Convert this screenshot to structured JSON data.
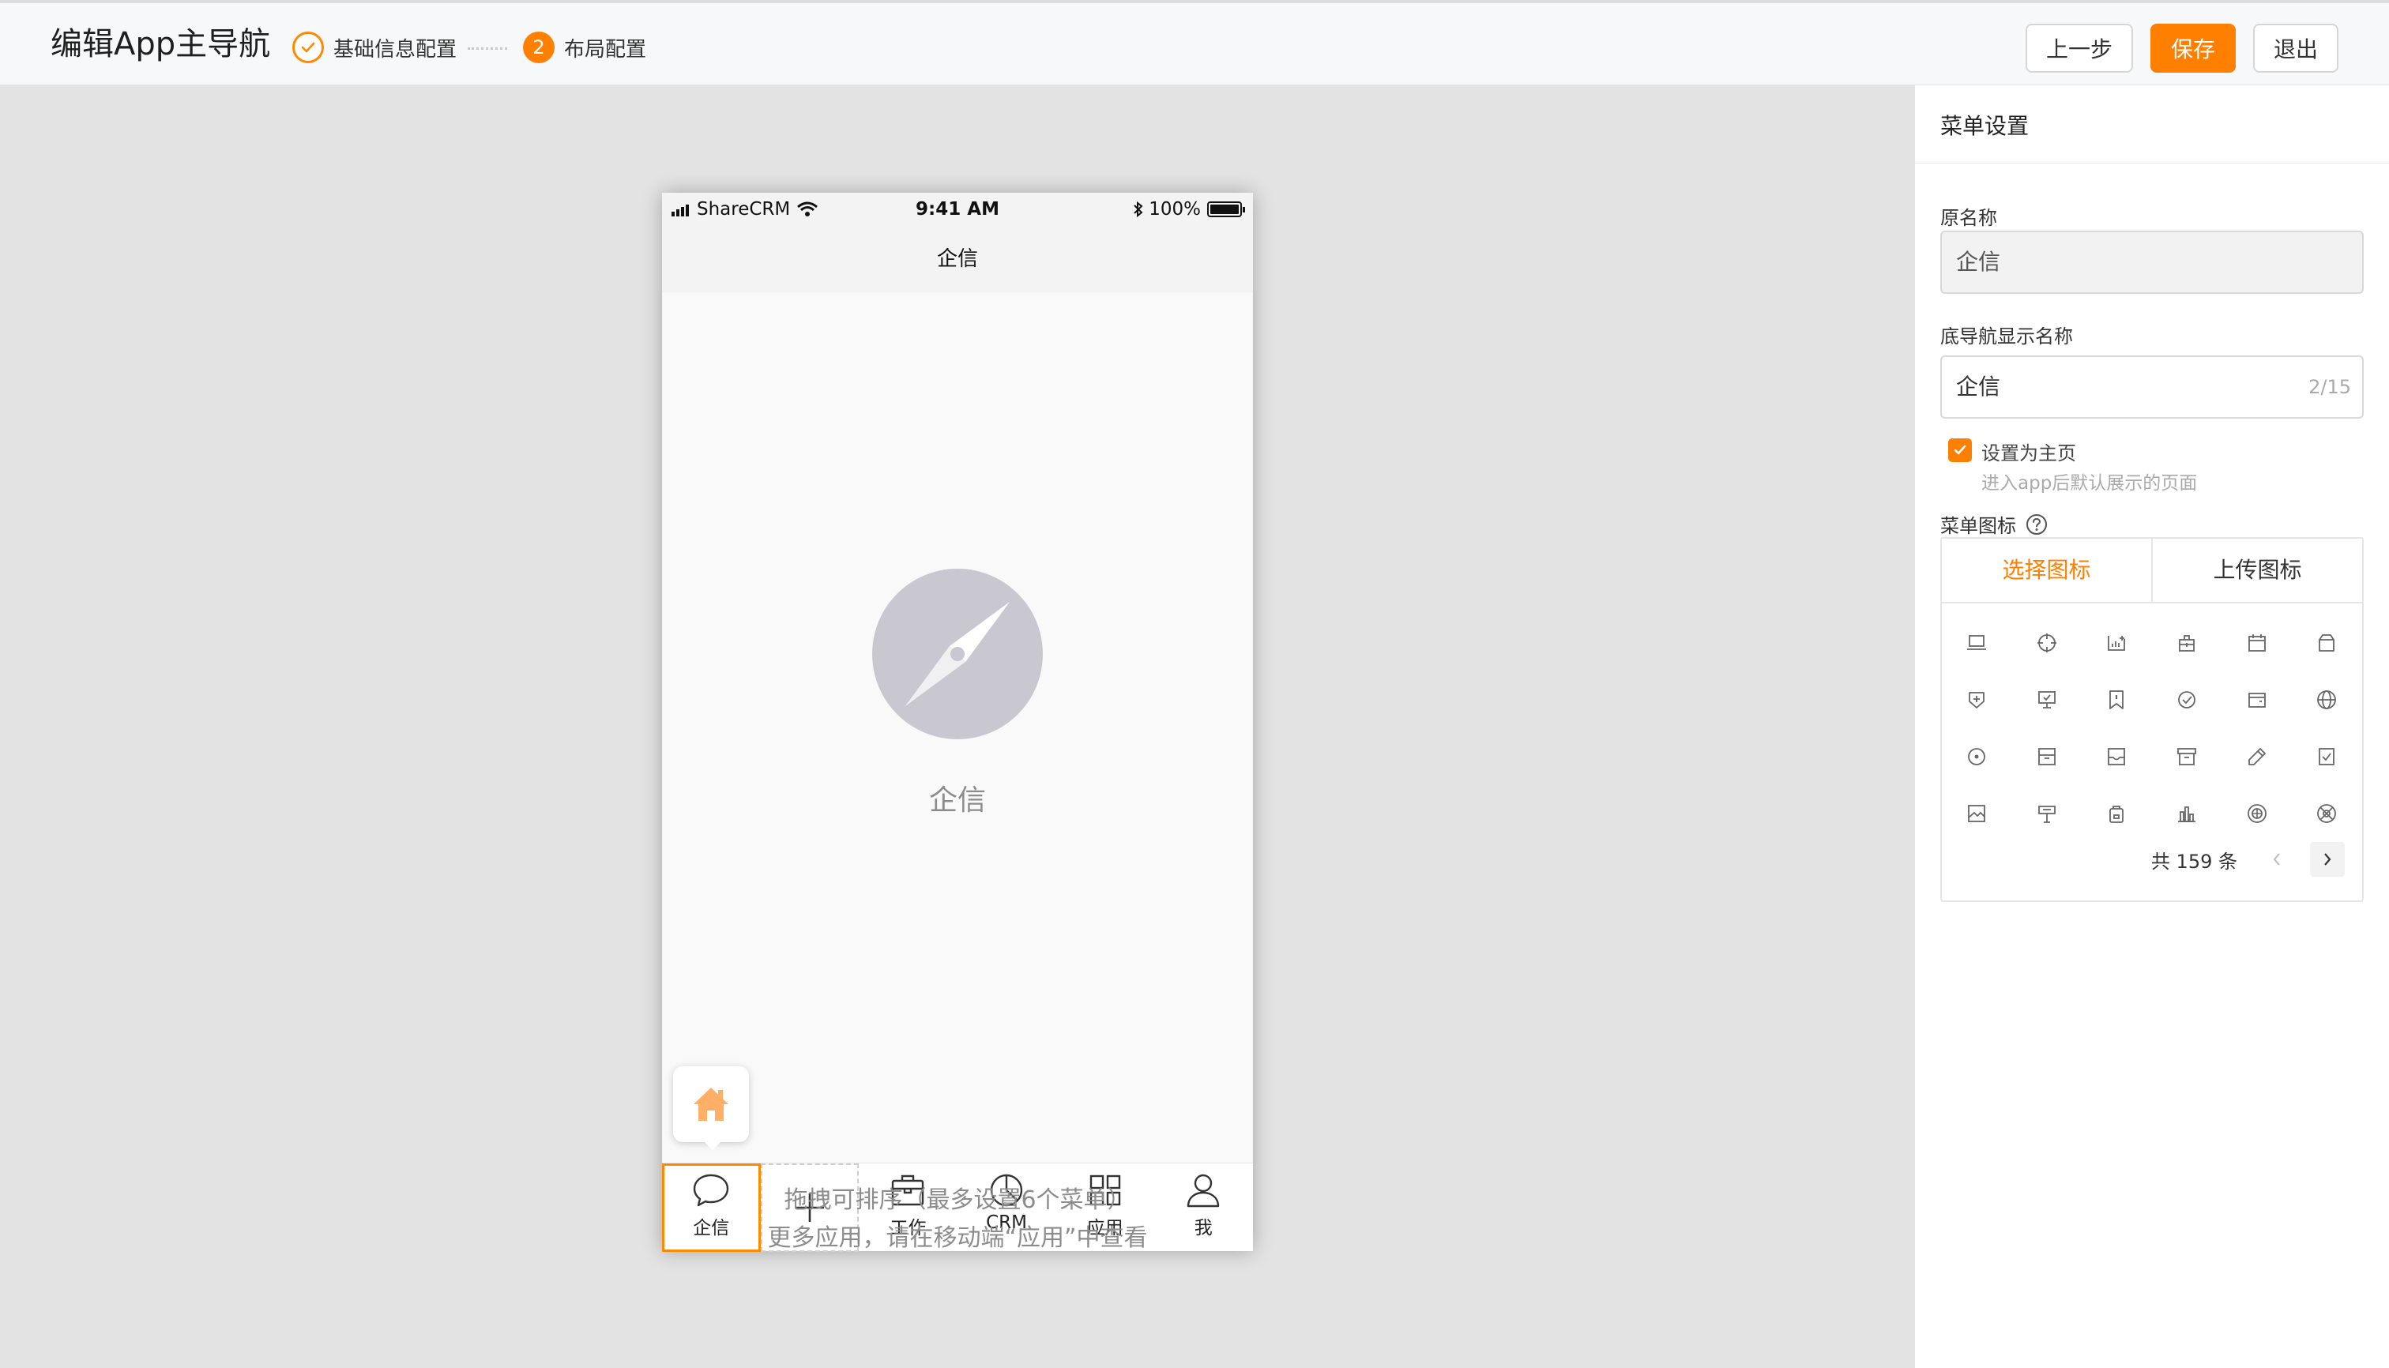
{
  "header": {
    "title": "编辑App主导航",
    "steps": [
      {
        "number": "1",
        "label": "基础信息配置",
        "state": "done"
      },
      {
        "number": "2",
        "label": "布局配置",
        "state": "active"
      }
    ],
    "buttons": {
      "prev": "上一步",
      "save": "保存",
      "exit": "退出"
    }
  },
  "colors": {
    "accent": "#ff7f00",
    "icon_gray": "#c9c8d0"
  },
  "phone": {
    "status": {
      "carrier": "ShareCRM",
      "time": "9:41 AM",
      "battery": "100%"
    },
    "nav_title": "企信",
    "empty_label": "企信",
    "home_icon": "home-icon",
    "tabs": [
      {
        "label": "企信",
        "icon": "chat-bubble-icon",
        "selected": true
      },
      {
        "label": "",
        "icon": "plus-icon",
        "add": true
      },
      {
        "label": "工作",
        "icon": "briefcase-icon"
      },
      {
        "label": "CRM",
        "icon": "pie-chart-icon"
      },
      {
        "label": "应用",
        "icon": "grid-icon"
      },
      {
        "label": "我",
        "icon": "person-icon"
      }
    ]
  },
  "hints": {
    "line1": "拖拽可排序（最多设置6个菜单）",
    "line2": "更多应用，请在移动端“应用”中查看"
  },
  "panel": {
    "title": "菜单设置",
    "original_name_label": "原名称",
    "original_name_value": "企信",
    "display_name_label": "底导航显示名称",
    "display_name_value": "企信",
    "display_name_counter": "2/15",
    "homepage_checkbox_label": "设置为主页",
    "homepage_checkbox_desc": "进入app后默认展示的页面",
    "homepage_checked": true,
    "menu_icon_label": "菜单图标",
    "icon_tabs": {
      "choose": "选择图标",
      "upload": "上传图标"
    },
    "icon_grid": [
      [
        "laptop-icon",
        "crosshair-icon",
        "chart-board-icon",
        "briefcase-lock-icon",
        "calendar-icon",
        "bag-icon"
      ],
      [
        "shield-plus-icon",
        "presentation-icon",
        "bookmark-icon",
        "check-circle-icon",
        "wallet-icon",
        "globe-icon"
      ],
      [
        "disc-icon",
        "cabinet-icon",
        "inbox-icon",
        "archive-icon",
        "pencil-icon",
        "checklist-icon"
      ],
      [
        "image-icon",
        "signpost-icon",
        "bag-secure-icon",
        "bar-chart-icon",
        "target-icon",
        "aperture-icon"
      ]
    ],
    "pagination_total": "共 159 条"
  }
}
